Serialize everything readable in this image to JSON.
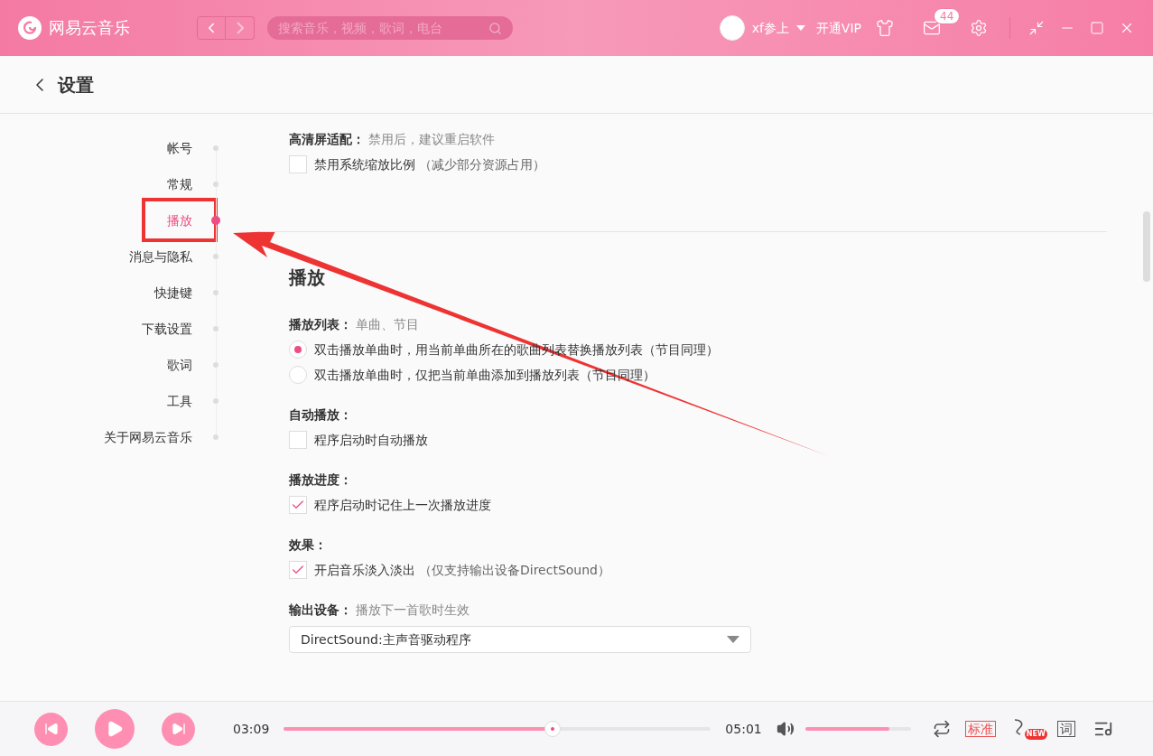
{
  "titlebar": {
    "logo_text": "网易云音乐",
    "search": {
      "placeholder": "搜索音乐，视频，歌词，电台"
    },
    "user": {
      "name": "xf参上"
    },
    "vip": "开通VIP",
    "mail_badge": "44"
  },
  "page": {
    "title": "设置"
  },
  "sidebar": {
    "items": [
      {
        "label": "帐号",
        "selected": false
      },
      {
        "label": "常规",
        "selected": false
      },
      {
        "label": "播放",
        "selected": true
      },
      {
        "label": "消息与隐私",
        "selected": false
      },
      {
        "label": "快捷键",
        "selected": false
      },
      {
        "label": "下载设置",
        "selected": false
      },
      {
        "label": "歌词",
        "selected": false
      },
      {
        "label": "工具",
        "selected": false
      },
      {
        "label": "关于网易云音乐",
        "selected": false
      }
    ]
  },
  "top_group": {
    "label": "高清屏适配：",
    "hint": "禁用后，建议重启软件",
    "options": [
      {
        "kind": "checkbox",
        "label": "禁用系统缩放比例",
        "note": "（减少部分资源占用）",
        "checked": false
      }
    ]
  },
  "section": {
    "heading": "播放",
    "groups": [
      {
        "label": "播放列表：",
        "hint": "单曲、节目",
        "options": [
          {
            "kind": "radio",
            "label": "双击播放单曲时，用当前单曲所在的歌曲列表替换播放列表（节目同理）",
            "selected": true
          },
          {
            "kind": "radio",
            "label": "双击播放单曲时，仅把当前单曲添加到播放列表（节目同理）",
            "selected": false
          }
        ]
      },
      {
        "label": "自动播放：",
        "options": [
          {
            "kind": "checkbox",
            "label": "程序启动时自动播放",
            "checked": false
          }
        ]
      },
      {
        "label": "播放进度：",
        "options": [
          {
            "kind": "checkbox",
            "label": "程序启动时记住上一次播放进度",
            "checked": true
          }
        ]
      },
      {
        "label": "效果：",
        "options": [
          {
            "kind": "checkbox",
            "label": "开启音乐淡入淡出",
            "note": "（仅支持输出设备DirectSound）",
            "checked": true
          }
        ]
      },
      {
        "label": "输出设备：",
        "hint": "播放下一首歌时生效",
        "options": [
          {
            "kind": "select",
            "value": "DirectSound:主声音驱动程序"
          }
        ]
      }
    ]
  },
  "player": {
    "elapsed": "03:09",
    "progress": {
      "level": 0.63
    },
    "duration": "05:01",
    "volume": {
      "level": 0.8
    },
    "quality": "标准",
    "new_badge": "NEW",
    "lyrics_button": "词"
  }
}
